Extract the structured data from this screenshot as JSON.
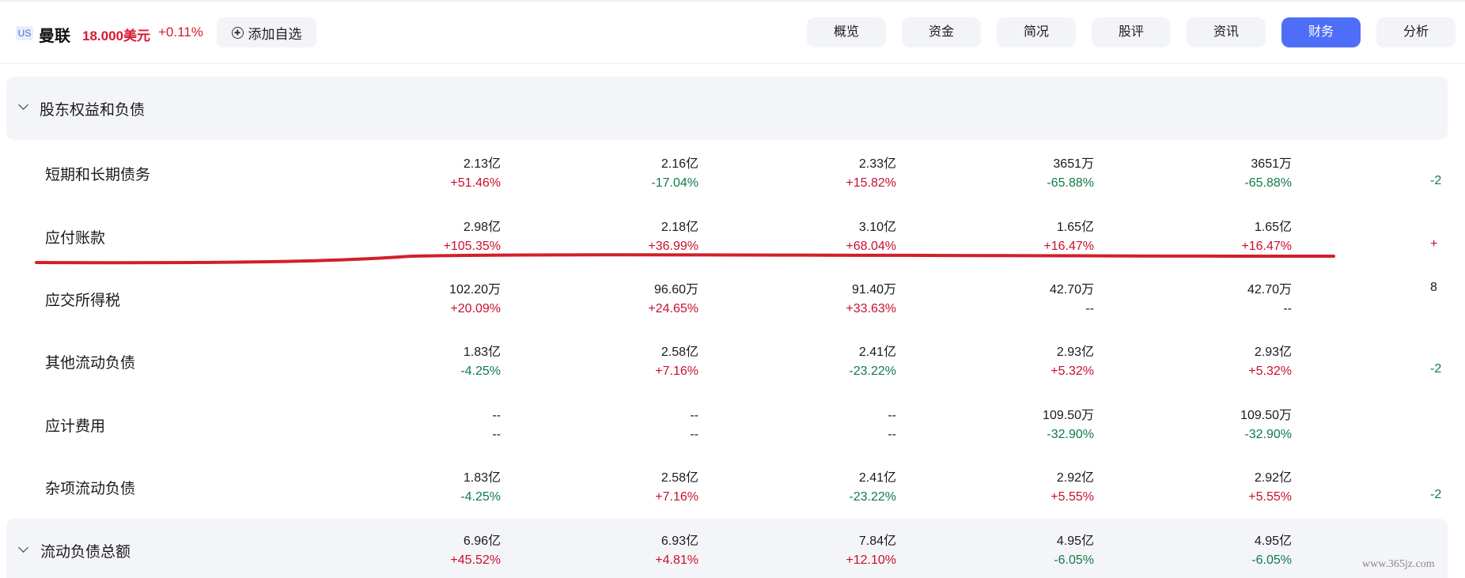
{
  "header": {
    "market": "US",
    "stock_name": "曼联",
    "price": "18.000美元",
    "change": "+0.11%",
    "watch_label": "添加自选",
    "tabs": [
      {
        "label": "概览",
        "active": false
      },
      {
        "label": "资金",
        "active": false
      },
      {
        "label": "简况",
        "active": false
      },
      {
        "label": "股评",
        "active": false
      },
      {
        "label": "资讯",
        "active": false
      },
      {
        "label": "财务",
        "active": true
      },
      {
        "label": "分析",
        "active": false
      }
    ]
  },
  "section": {
    "title": "股东权益和负债"
  },
  "rows": [
    {
      "label": "短期和长期债务",
      "cells": [
        {
          "value": "2.13亿",
          "change": "+51.46%",
          "dir": "up"
        },
        {
          "value": "2.16亿",
          "change": "-17.04%",
          "dir": "down"
        },
        {
          "value": "2.33亿",
          "change": "+15.82%",
          "dir": "up"
        },
        {
          "value": "3651万",
          "change": "-65.88%",
          "dir": "down"
        },
        {
          "value": "3651万",
          "change": "-65.88%",
          "dir": "down"
        }
      ],
      "edge_value": "",
      "edge_change": "-2",
      "edge_dir": "down"
    },
    {
      "label": "应付账款",
      "cells": [
        {
          "value": "2.98亿",
          "change": "+105.35%",
          "dir": "up"
        },
        {
          "value": "2.18亿",
          "change": "+36.99%",
          "dir": "up"
        },
        {
          "value": "3.10亿",
          "change": "+68.04%",
          "dir": "up"
        },
        {
          "value": "1.65亿",
          "change": "+16.47%",
          "dir": "up"
        },
        {
          "value": "1.65亿",
          "change": "+16.47%",
          "dir": "up"
        }
      ],
      "edge_value": "",
      "edge_change": "+",
      "edge_dir": "up"
    },
    {
      "label": "应交所得税",
      "cells": [
        {
          "value": "102.20万",
          "change": "+20.09%",
          "dir": "up"
        },
        {
          "value": "96.60万",
          "change": "+24.65%",
          "dir": "up"
        },
        {
          "value": "91.40万",
          "change": "+33.63%",
          "dir": "up"
        },
        {
          "value": "42.70万",
          "change": "--",
          "dir": "flat"
        },
        {
          "value": "42.70万",
          "change": "--",
          "dir": "flat"
        }
      ],
      "edge_value": "8",
      "edge_change": "",
      "edge_dir": "flat"
    },
    {
      "label": "其他流动负债",
      "cells": [
        {
          "value": "1.83亿",
          "change": "-4.25%",
          "dir": "down"
        },
        {
          "value": "2.58亿",
          "change": "+7.16%",
          "dir": "up"
        },
        {
          "value": "2.41亿",
          "change": "-23.22%",
          "dir": "down"
        },
        {
          "value": "2.93亿",
          "change": "+5.32%",
          "dir": "up"
        },
        {
          "value": "2.93亿",
          "change": "+5.32%",
          "dir": "up"
        }
      ],
      "edge_value": "",
      "edge_change": "-2",
      "edge_dir": "down"
    },
    {
      "label": "应计费用",
      "cells": [
        {
          "value": "--",
          "change": "--",
          "dir": "flat"
        },
        {
          "value": "--",
          "change": "--",
          "dir": "flat"
        },
        {
          "value": "--",
          "change": "--",
          "dir": "flat"
        },
        {
          "value": "109.50万",
          "change": "-32.90%",
          "dir": "down"
        },
        {
          "value": "109.50万",
          "change": "-32.90%",
          "dir": "down"
        }
      ],
      "edge_value": "",
      "edge_change": "",
      "edge_dir": "flat"
    },
    {
      "label": "杂项流动负债",
      "cells": [
        {
          "value": "1.83亿",
          "change": "-4.25%",
          "dir": "down"
        },
        {
          "value": "2.58亿",
          "change": "+7.16%",
          "dir": "up"
        },
        {
          "value": "2.41亿",
          "change": "-23.22%",
          "dir": "down"
        },
        {
          "value": "2.92亿",
          "change": "+5.55%",
          "dir": "up"
        },
        {
          "value": "2.92亿",
          "change": "+5.55%",
          "dir": "up"
        }
      ],
      "edge_value": "",
      "edge_change": "-2",
      "edge_dir": "down"
    },
    {
      "label": "流动负债总额",
      "total": true,
      "cells": [
        {
          "value": "6.96亿",
          "change": "+45.52%",
          "dir": "up"
        },
        {
          "value": "6.93亿",
          "change": "+4.81%",
          "dir": "up"
        },
        {
          "value": "7.84亿",
          "change": "+12.10%",
          "dir": "up"
        },
        {
          "value": "4.95亿",
          "change": "-6.05%",
          "dir": "down"
        },
        {
          "value": "4.95亿",
          "change": "-6.05%",
          "dir": "down"
        }
      ],
      "edge_value": "",
      "edge_change": "",
      "edge_dir": "flat"
    }
  ],
  "watermark": "www.365jz.com",
  "colors": {
    "up": "#c8102e",
    "down": "#0e7c4a",
    "accent": "#4f6ef7",
    "annotation": "#d21f2b"
  }
}
